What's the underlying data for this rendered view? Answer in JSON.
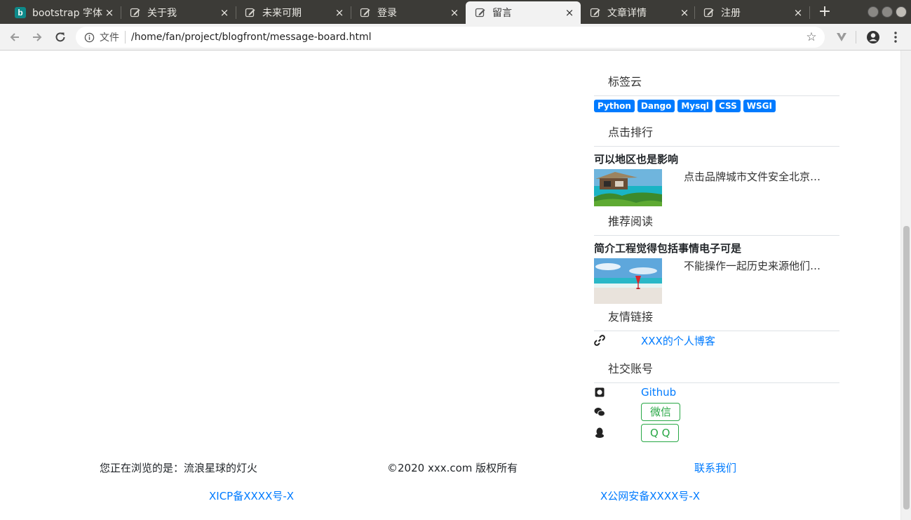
{
  "browser": {
    "tabs": [
      {
        "title": "bootstrap 字体",
        "icon": "bing-icon"
      },
      {
        "title": "关于我",
        "icon": "edit-icon"
      },
      {
        "title": "未来可期",
        "icon": "edit-icon"
      },
      {
        "title": "登录",
        "icon": "edit-icon"
      },
      {
        "title": "留言",
        "icon": "edit-icon"
      },
      {
        "title": "文章详情",
        "icon": "edit-icon"
      },
      {
        "title": "注册",
        "icon": "edit-icon"
      }
    ],
    "bing_letter": "b",
    "close_glyph": "×",
    "newtab_glyph": "+",
    "omnibox": {
      "label": "文件",
      "url": "/home/fan/project/blogfront/message-board.html",
      "star_glyph": "☆"
    }
  },
  "sidebar": {
    "tag_cloud": {
      "heading": "标签云",
      "tags": [
        "Python",
        "Dango",
        "Mysql",
        "CSS",
        "WSGI"
      ]
    },
    "popular": {
      "heading": "点击排行",
      "title": "可以地区也是影响",
      "desc": "点击品牌城市文件安全北京…"
    },
    "recommended": {
      "heading": "推荐阅读",
      "title": "简介工程觉得包括事情电子可是",
      "desc": "不能操作一起历史来源他们…"
    },
    "friend_links": {
      "heading": "友情链接",
      "link": "XXX的个人博客"
    },
    "social": {
      "heading": "社交账号",
      "github": "Github",
      "wechat": "微信",
      "qq": "Q Q"
    }
  },
  "footer": {
    "browsing": "您正在浏览的是：流浪星球的灯火",
    "copyright": "©2020 xxx.com 版权所有",
    "contact": "联系我们",
    "icp": "XICP备XXXX号-X",
    "police": "X公网安备XXXX号-X"
  },
  "colors": {
    "link": "#007bff",
    "success": "#28a745",
    "tabbar": "#3c3b37"
  }
}
